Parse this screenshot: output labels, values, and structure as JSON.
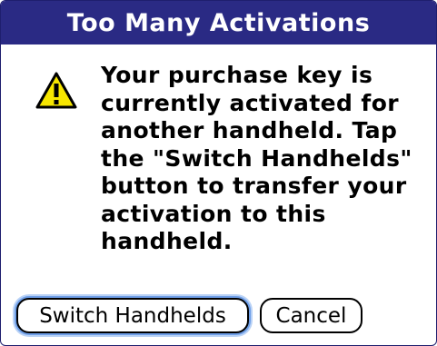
{
  "dialog": {
    "title": "Too Many Activations",
    "icon": "warning-icon",
    "message_lines": [
      "Your purchase key is",
      "currently activated for",
      "another handheld.  Tap",
      "the \"Switch Handhelds\"",
      "button to transfer your",
      "activation to this",
      "handheld."
    ],
    "buttons": {
      "switch_label": "Switch Handhelds",
      "cancel_label": "Cancel"
    }
  },
  "colors": {
    "titlebar": "#2a2a84",
    "title_text": "#ffffff",
    "warning_fill": "#f7e600",
    "focus_ring": "#6f9fe8"
  }
}
